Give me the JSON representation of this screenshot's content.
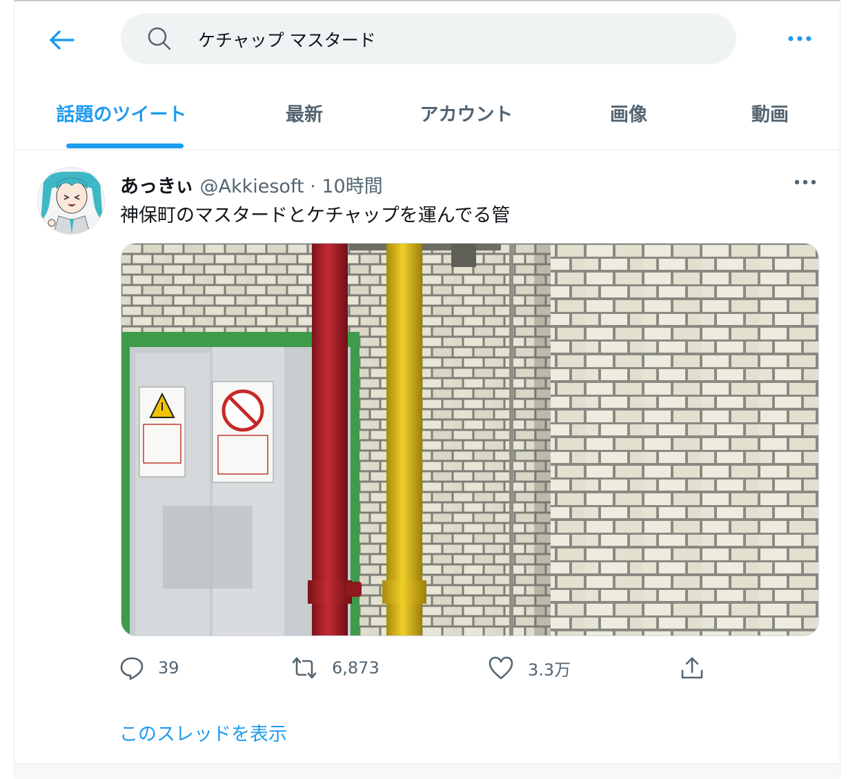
{
  "search": {
    "query": "ケチャップ マスタード"
  },
  "tabs": [
    {
      "label": "話題のツイート",
      "active": true
    },
    {
      "label": "最新"
    },
    {
      "label": "アカウント"
    },
    {
      "label": "画像"
    },
    {
      "label": "動画"
    }
  ],
  "tweet": {
    "display_name": "あっきぃ",
    "handle": "@Akkiesoft",
    "separator": "·",
    "time": "10時間",
    "text": "神保町のマスタードとケチャップを運んでる管",
    "actions": {
      "reply_count": "39",
      "retweet_count": "6,873",
      "like_count": "3.3万"
    },
    "thread_link": "このスレッドを表示"
  },
  "colors": {
    "accent": "#1d9bf0",
    "secondary_text": "#536471",
    "search_bg": "#eff3f4",
    "ketchup_pipe": "#b3212a",
    "mustard_pipe": "#e8c11c"
  },
  "icons": [
    "back-arrow-icon",
    "search-icon",
    "more-icon",
    "reply-icon",
    "retweet-icon",
    "like-icon",
    "share-icon"
  ]
}
